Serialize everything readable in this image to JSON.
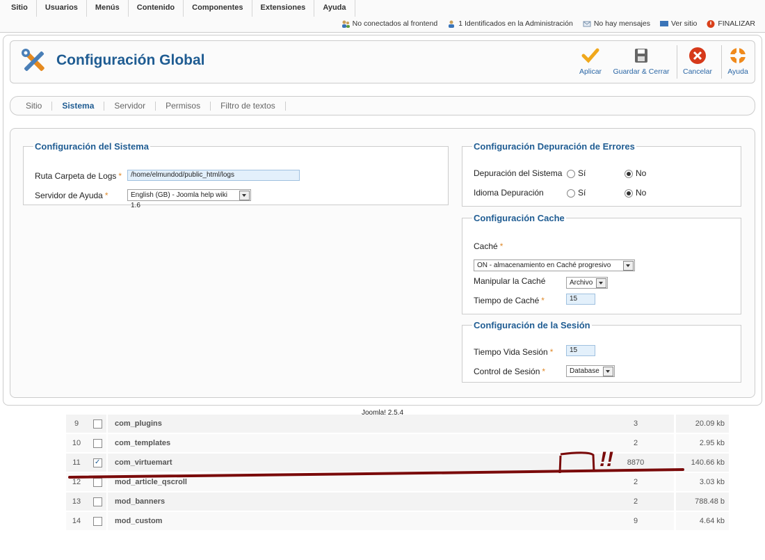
{
  "menu": [
    "Sitio",
    "Usuarios",
    "Menús",
    "Contenido",
    "Componentes",
    "Extensiones",
    "Ayuda"
  ],
  "status": {
    "frontend": "No conectados al frontend",
    "admin": "1 Identificados en la Administración",
    "messages": "No hay mensajes",
    "view_site": "Ver sitio",
    "logout": "FINALIZAR"
  },
  "toolbar": {
    "title": "Configuración Global",
    "apply": "Aplicar",
    "save_close": "Guardar & Cerrar",
    "cancel": "Cancelar",
    "help": "Ayuda"
  },
  "tabs": [
    "Sitio",
    "Sistema",
    "Servidor",
    "Permisos",
    "Filtro de textos"
  ],
  "active_tab": "Sistema",
  "system": {
    "legend": "Configuración del Sistema",
    "logs_label": "Ruta Carpeta de Logs",
    "logs_value": "/home/elmundod/public_html/logs",
    "help_label": "Servidor de Ayuda",
    "help_value": "English (GB) - Joomla help wiki 1.6"
  },
  "debug": {
    "legend": "Configuración Depuración de Errores",
    "sys_label": "Depuración del Sistema",
    "lang_label": "Idioma Depuración",
    "yes": "Sí",
    "no": "No"
  },
  "cache": {
    "legend": "Configuración Cache",
    "cache_label": "Caché",
    "cache_value": "ON - almacenamiento en Caché progresivo",
    "handler_label": "Manipular la Caché",
    "handler_value": "Archivo",
    "time_label": "Tiempo de Caché",
    "time_value": "15"
  },
  "session": {
    "legend": "Configuración de la Sesión",
    "lifetime_label": "Tiempo Vida Sesión",
    "lifetime_value": "15",
    "handler_label": "Control de Sesión",
    "handler_value": "Database"
  },
  "footer": "Joomla! 2.5.4",
  "table_rows": [
    {
      "num": "9",
      "checked": false,
      "name": "com_plugins",
      "count": "3",
      "size": "20.09 kb"
    },
    {
      "num": "10",
      "checked": false,
      "name": "com_templates",
      "count": "2",
      "size": "2.95 kb"
    },
    {
      "num": "11",
      "checked": true,
      "name": "com_virtuemart",
      "count": "8870",
      "size": "140.66 kb"
    },
    {
      "num": "12",
      "checked": false,
      "name": "mod_article_qscroll",
      "count": "2",
      "size": "3.03 kb"
    },
    {
      "num": "13",
      "checked": false,
      "name": "mod_banners",
      "count": "2",
      "size": "788.48 b"
    },
    {
      "num": "14",
      "checked": false,
      "name": "mod_custom",
      "count": "9",
      "size": "4.64 kb"
    }
  ],
  "annotation": "!!",
  "colors": {
    "title": "#1f5c92",
    "link": "#2a66a5",
    "required": "#e08a2b",
    "annotation": "#7a0a0a"
  }
}
